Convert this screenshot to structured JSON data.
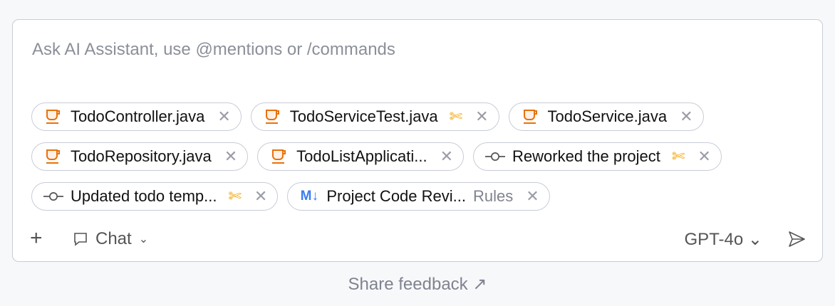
{
  "input": {
    "placeholder": "Ask AI Assistant, use @mentions or /commands"
  },
  "chips": [
    {
      "label": "TodoController.java",
      "icon": "java-file-icon",
      "scissors": false
    },
    {
      "label": "TodoServiceTest.java",
      "icon": "java-file-icon",
      "scissors": true
    },
    {
      "label": "TodoService.java",
      "icon": "java-file-icon",
      "scissors": false
    },
    {
      "label": "TodoRepository.java",
      "icon": "java-file-icon",
      "scissors": false
    },
    {
      "label": "TodoListApplicati...",
      "icon": "java-file-icon",
      "scissors": false
    },
    {
      "label": "Reworked the project",
      "icon": "commit-icon",
      "scissors": true
    },
    {
      "label": "Updated todo temp...",
      "icon": "commit-icon",
      "scissors": true
    },
    {
      "label": "Project Code Revi...",
      "icon": "markdown-icon",
      "scissors": false,
      "extra": "Rules"
    }
  ],
  "toolbar": {
    "add": "+",
    "mode": "Chat",
    "model": "GPT-4o ⌄"
  },
  "footer": {
    "feedback": "Share feedback ↗"
  },
  "colors": {
    "java": "#e8710a",
    "scissors": "#f5a400",
    "markdown": "#3b7cf2"
  }
}
